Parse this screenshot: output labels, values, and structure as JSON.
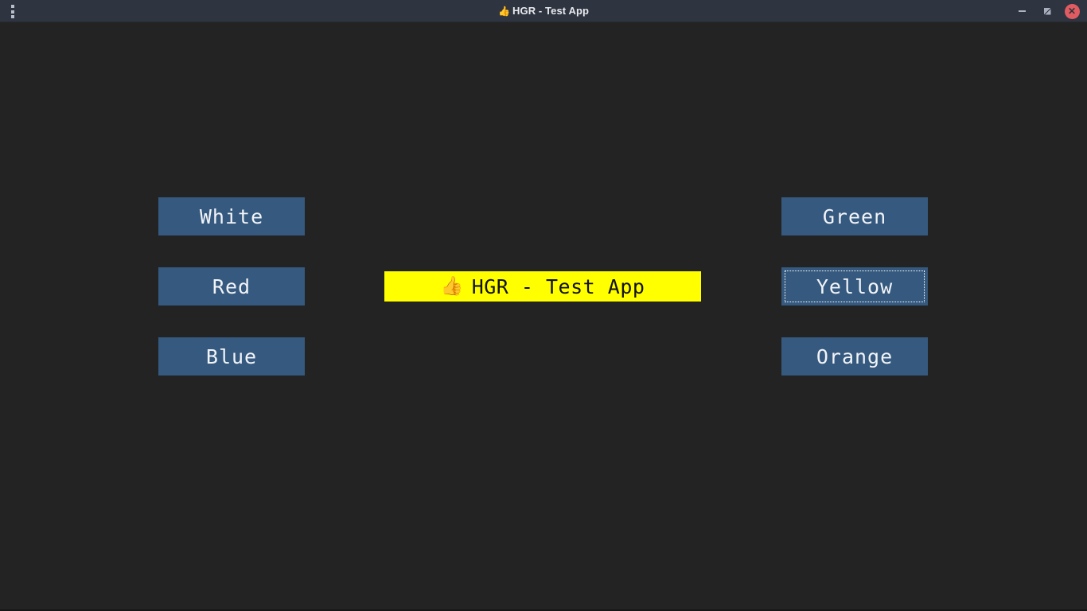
{
  "window": {
    "title": "HGR - Test App",
    "title_emoji": "👍",
    "background_color": "#232323",
    "titlebar_color": "#2e3440"
  },
  "titlebar": {
    "menu_icon": "kebab-menu-icon",
    "minimize_label": "–",
    "maximize_label": "",
    "close_label": "✕"
  },
  "banner": {
    "emoji": "👍",
    "text": "HGR - Test App",
    "background_color": "#ffff00",
    "text_color": "#111111"
  },
  "buttons": {
    "accent_color": "#35597f",
    "text_color": "#f2f4f7",
    "left_column": [
      {
        "id": "white",
        "label": "White",
        "focused": false
      },
      {
        "id": "red",
        "label": "Red",
        "focused": false
      },
      {
        "id": "blue",
        "label": "Blue",
        "focused": false
      }
    ],
    "right_column": [
      {
        "id": "green",
        "label": "Green",
        "focused": false
      },
      {
        "id": "yellow",
        "label": "Yellow",
        "focused": true
      },
      {
        "id": "orange",
        "label": "Orange",
        "focused": false
      }
    ]
  }
}
